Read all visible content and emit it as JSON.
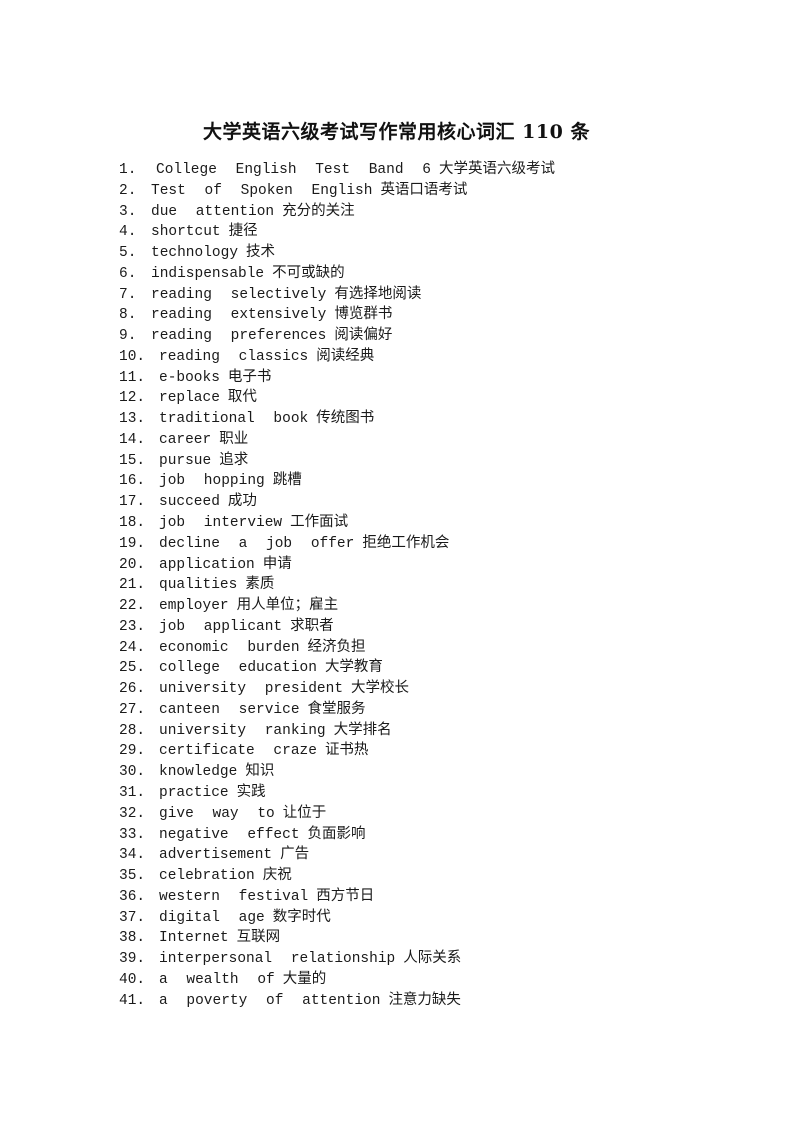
{
  "document": {
    "title": "大学英语六级考试写作常用核心词汇 110 条",
    "items": [
      {
        "num": "1.",
        "en": "College English Test Band 6",
        "zh": "大学英语六级考试"
      },
      {
        "num": "2.",
        "en": "Test of Spoken English",
        "zh": "英语口语考试"
      },
      {
        "num": "3.",
        "en": "due attention",
        "zh": "充分的关注"
      },
      {
        "num": "4.",
        "en": "shortcut",
        "zh": "捷径"
      },
      {
        "num": "5.",
        "en": "technology",
        "zh": "技术"
      },
      {
        "num": "6.",
        "en": "indispensable",
        "zh": "不可或缺的"
      },
      {
        "num": "7.",
        "en": "reading selectively",
        "zh": "有选择地阅读"
      },
      {
        "num": "8.",
        "en": "reading extensively",
        "zh": "博览群书"
      },
      {
        "num": "9.",
        "en": "reading preferences",
        "zh": "阅读偏好"
      },
      {
        "num": "10.",
        "en": "reading classics",
        "zh": "阅读经典"
      },
      {
        "num": "11.",
        "en": "e-books",
        "zh": "电子书"
      },
      {
        "num": "12.",
        "en": "replace",
        "zh": "取代"
      },
      {
        "num": "13.",
        "en": "traditional book",
        "zh": "传统图书"
      },
      {
        "num": "14.",
        "en": "career",
        "zh": "职业"
      },
      {
        "num": "15.",
        "en": "pursue",
        "zh": "追求"
      },
      {
        "num": "16.",
        "en": "job hopping",
        "zh": "跳槽"
      },
      {
        "num": "17.",
        "en": "succeed",
        "zh": "成功"
      },
      {
        "num": "18.",
        "en": "job interview",
        "zh": "工作面试"
      },
      {
        "num": "19.",
        "en": "decline a job offer",
        "zh": "拒绝工作机会"
      },
      {
        "num": "20.",
        "en": "application",
        "zh": "申请"
      },
      {
        "num": "21.",
        "en": "qualities",
        "zh": "素质"
      },
      {
        "num": "22.",
        "en": "employer",
        "zh": "用人单位；雇主"
      },
      {
        "num": "23.",
        "en": "job applicant",
        "zh": "求职者"
      },
      {
        "num": "24.",
        "en": "economic burden",
        "zh": "经济负担"
      },
      {
        "num": "25.",
        "en": "college education",
        "zh": "大学教育"
      },
      {
        "num": "26.",
        "en": "university president",
        "zh": "大学校长"
      },
      {
        "num": "27.",
        "en": "canteen service",
        "zh": "食堂服务"
      },
      {
        "num": "28.",
        "en": "university ranking",
        "zh": "大学排名"
      },
      {
        "num": "29.",
        "en": "certificate craze",
        "zh": "证书热"
      },
      {
        "num": "30.",
        "en": "knowledge",
        "zh": "知识"
      },
      {
        "num": "31.",
        "en": "practice",
        "zh": "实践"
      },
      {
        "num": "32.",
        "en": "give way to",
        "zh": "让位于"
      },
      {
        "num": "33.",
        "en": "negative effect",
        "zh": "负面影响"
      },
      {
        "num": "34.",
        "en": "advertisement",
        "zh": "广告"
      },
      {
        "num": "35.",
        "en": "celebration",
        "zh": "庆祝"
      },
      {
        "num": "36.",
        "en": "western festival",
        "zh": "西方节日"
      },
      {
        "num": "37.",
        "en": "digital age",
        "zh": "数字时代"
      },
      {
        "num": "38.",
        "en": "Internet",
        "zh": "互联网"
      },
      {
        "num": "39.",
        "en": "interpersonal relationship",
        "zh": "人际关系"
      },
      {
        "num": "40.",
        "en": "a wealth of",
        "zh": "大量的"
      },
      {
        "num": "41.",
        "en": "a poverty of attention",
        "zh": "注意力缺失"
      }
    ]
  }
}
